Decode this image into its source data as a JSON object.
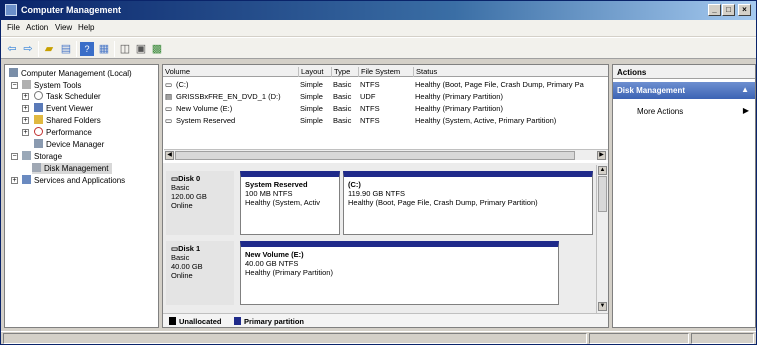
{
  "window": {
    "title": "Computer Management",
    "minimize": "_",
    "maximize": "□",
    "close": "×"
  },
  "menu": [
    "File",
    "Action",
    "View",
    "Help"
  ],
  "toolbar_icons": [
    "back-arrow-icon",
    "forward-arrow-icon",
    "up-folder-icon",
    "show-hide-tree-icon",
    "help-icon",
    "console-icon",
    "export-icon",
    "properties-icon",
    "disk-icon"
  ],
  "tree": {
    "root": "Computer Management (Local)",
    "system_tools": "System Tools",
    "task_scheduler": "Task Scheduler",
    "event_viewer": "Event Viewer",
    "shared_folders": "Shared Folders",
    "performance": "Performance",
    "device_manager": "Device Manager",
    "storage": "Storage",
    "disk_management": "Disk Management",
    "services_apps": "Services and Applications",
    "expand_minus": "−",
    "expand_plus": "+"
  },
  "volume_table": {
    "columns": [
      "Volume",
      "Layout",
      "Type",
      "File System",
      "Status"
    ],
    "rows": [
      [
        "(C:)",
        "Simple",
        "Basic",
        "NTFS",
        "Healthy (Boot, Page File, Crash Dump, Primary Pa"
      ],
      [
        "GRISSBxFRE_EN_DVD_1 (D:)",
        "Simple",
        "Basic",
        "UDF",
        "Healthy (Primary Partition)"
      ],
      [
        "New Volume (E:)",
        "Simple",
        "Basic",
        "NTFS",
        "Healthy (Primary Partition)"
      ],
      [
        "System Reserved",
        "Simple",
        "Basic",
        "NTFS",
        "Healthy (System, Active, Primary Partition)"
      ]
    ]
  },
  "disks": [
    {
      "name": "Disk 0",
      "type": "Basic",
      "size": "120.00 GB",
      "state": "Online",
      "partitions": [
        {
          "name": "System Reserved",
          "size": "100 MB NTFS",
          "status": "Healthy (System, Activ"
        },
        {
          "name": "(C:)",
          "size": "119.90 GB NTFS",
          "status": "Healthy (Boot, Page File, Crash Dump, Primary Partition)"
        }
      ]
    },
    {
      "name": "Disk 1",
      "type": "Basic",
      "size": "40.00 GB",
      "state": "Online",
      "partitions": [
        {
          "name": "New Volume  (E:)",
          "size": "40.00 GB NTFS",
          "status": "Healthy (Primary Partition)"
        }
      ]
    }
  ],
  "legend": {
    "unallocated": "Unallocated",
    "primary": "Primary partition",
    "unallocated_color": "#000000",
    "primary_color": "#1f2a8a"
  },
  "actions": {
    "header": "Actions",
    "section": "Disk Management",
    "more": "More Actions",
    "collapse_glyph": "▲",
    "submenu_glyph": "▶"
  },
  "scroll": {
    "left": "◀",
    "right": "▶",
    "up": "▲",
    "down": "▼"
  }
}
